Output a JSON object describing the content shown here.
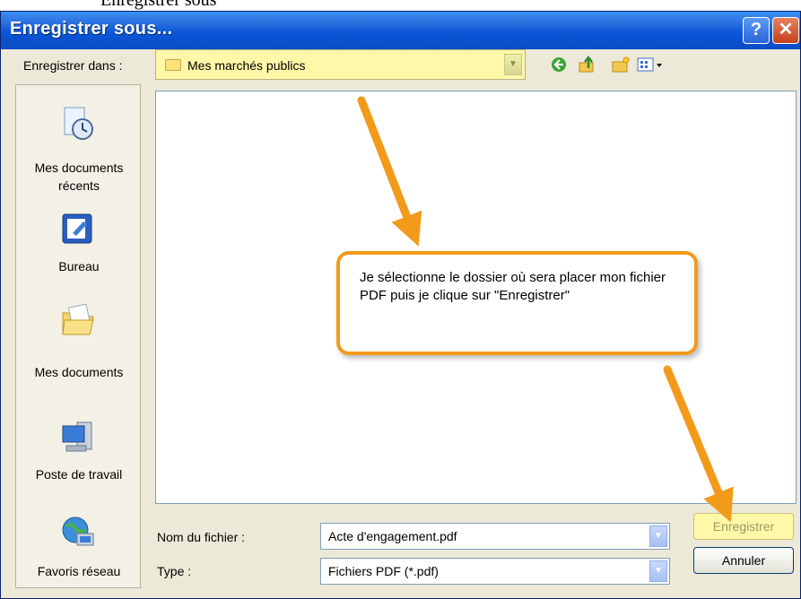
{
  "caption": "Enregistrer sous",
  "window": {
    "title": "Enregistrer sous...",
    "help": "?",
    "close": "✕"
  },
  "save_in": {
    "label": "Enregistrer dans :",
    "value": "Mes marchés publics"
  },
  "toolbar": {
    "icons": [
      "back-icon",
      "up-folder-icon",
      "new-folder-icon",
      "views-menu-icon"
    ]
  },
  "places": [
    {
      "label": "Mes documents récents",
      "icon": "recent-documents-icon"
    },
    {
      "label": "Bureau",
      "icon": "desktop-icon"
    },
    {
      "label": "Mes documents",
      "icon": "my-documents-icon"
    },
    {
      "label": "Poste de travail",
      "icon": "my-computer-icon"
    },
    {
      "label": "Favoris réseau",
      "icon": "network-places-icon"
    }
  ],
  "filename": {
    "label": "Nom du fichier :",
    "value": "Acte d'engagement.pdf"
  },
  "filetype": {
    "label": "Type :",
    "value": "Fichiers PDF (*.pdf)"
  },
  "buttons": {
    "save": "Enregistrer",
    "cancel": "Annuler"
  },
  "callout": {
    "text": "Je sélectionne le dossier où sera placer mon fichier PDF puis je clique sur \"Enregistrer\""
  },
  "colors": {
    "accent": "#f29a1a",
    "titlebar": "#0b56d8",
    "highlight": "#fff8a8"
  }
}
